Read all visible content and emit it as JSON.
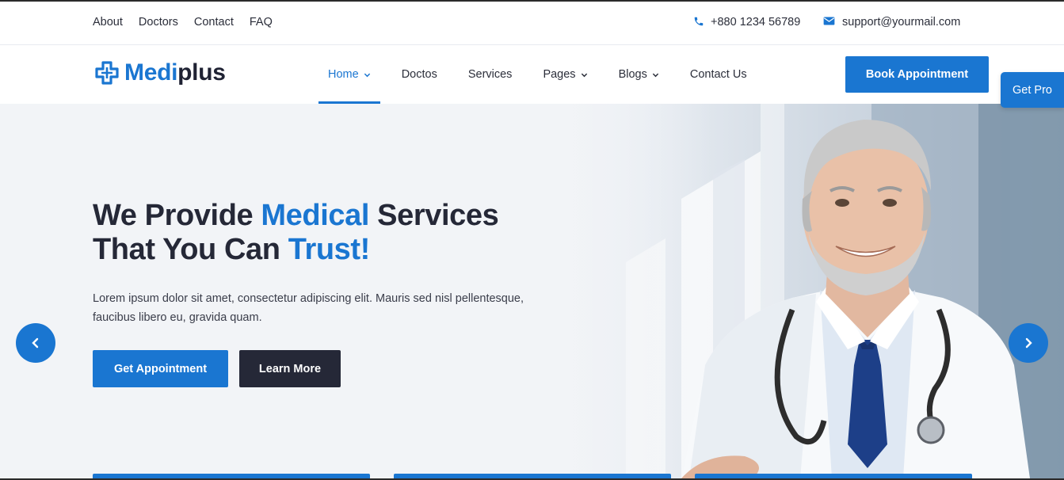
{
  "topbar": {
    "links": [
      "About",
      "Doctors",
      "Contact",
      "FAQ"
    ],
    "phone": "+880 1234 56789",
    "email": "support@yourmail.com"
  },
  "logo": {
    "part1": "Medi",
    "part2": "plus"
  },
  "nav": {
    "items": [
      {
        "label": "Home",
        "dropdown": true,
        "active": true
      },
      {
        "label": "Doctos",
        "dropdown": false
      },
      {
        "label": "Services",
        "dropdown": false
      },
      {
        "label": "Pages",
        "dropdown": true
      },
      {
        "label": "Blogs",
        "dropdown": true
      },
      {
        "label": "Contact Us",
        "dropdown": false
      }
    ],
    "cta": "Book Appointment"
  },
  "get_pro": "Get Pro",
  "hero": {
    "headline_1a": "We Provide ",
    "headline_1b": "Medical",
    "headline_1c": " Services",
    "headline_2a": "That You Can ",
    "headline_2b": "Trust!",
    "description": "Lorem ipsum dolor sit amet, consectetur adipiscing elit. Mauris sed nisl pellentesque, faucibus libero eu, gravida quam.",
    "primary_button": "Get Appointment",
    "secondary_button": "Learn More"
  },
  "colors": {
    "accent": "#1a76d1",
    "dark": "#252837",
    "hero_bg": "#f2f4f7"
  },
  "icons": {
    "phone": "phone-icon",
    "email": "mail-icon",
    "prev": "chevron-left-icon",
    "next": "chevron-right-icon",
    "logo": "medical-cross-icon"
  }
}
